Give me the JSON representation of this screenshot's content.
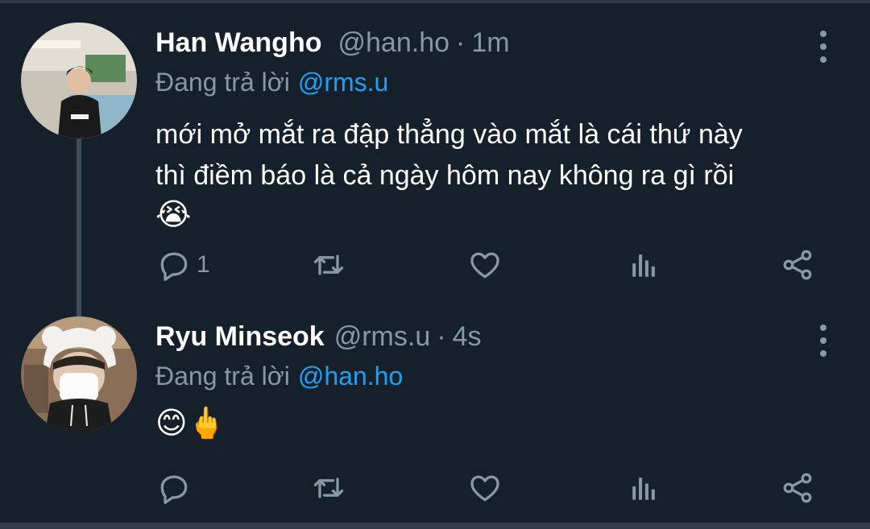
{
  "tweets": [
    {
      "name": "Han Wangho",
      "handle": "@han.ho",
      "separator": "·",
      "time": "1m",
      "replying_prefix": "Đang trả lời",
      "replying_to": "@rms.u",
      "text_lines": [
        "mới mở mắt ra đập thẳng vào mắt là cái thứ này",
        "thì điềm báo là cả ngày hôm nay không ra gì rồi"
      ],
      "emoji": "😭",
      "reply_count": "1",
      "icons": [
        "reply-icon",
        "retweet-icon",
        "like-icon",
        "stats-icon",
        "share-icon",
        "more-icon"
      ]
    },
    {
      "name": "Ryu Minseok",
      "handle": "@rms.u",
      "separator": "·",
      "time": "4s",
      "replying_prefix": "Đang trả lời",
      "replying_to": "@han.ho",
      "emoji": "😊🖕",
      "reply_count": "",
      "icons": [
        "reply-icon",
        "retweet-icon",
        "like-icon",
        "stats-icon",
        "share-icon",
        "more-icon"
      ]
    }
  ],
  "colors": {
    "background": "#15202b",
    "secondary_text": "#8899a6",
    "link": "#1da1f2",
    "thread_line": "#3d4c59"
  }
}
